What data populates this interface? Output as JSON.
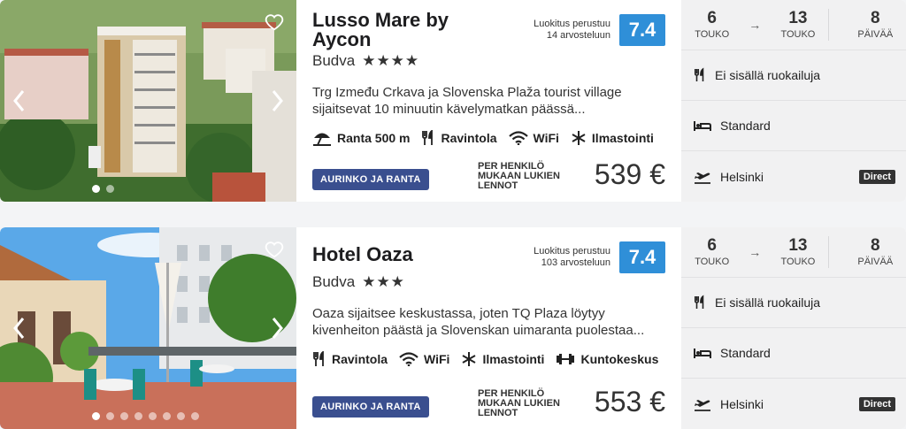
{
  "hotels": [
    {
      "name": "Lusso Mare by Aycon",
      "city": "Budva",
      "stars": "★★★★",
      "rating_label": "Luokitus perustuu",
      "rating_count": "14 arvosteluun",
      "rating_score": "7.4",
      "description": "Trg Između Crkava ja Slovenska Plaža tourist village sijaitsevat 10 minuutin kävelymatkan päässä...",
      "amenities": [
        {
          "icon": "beach-umbrella-icon",
          "label": "Ranta 500 m"
        },
        {
          "icon": "restaurant-icon",
          "label": "Ravintola"
        },
        {
          "icon": "wifi-icon",
          "label": "WiFi"
        },
        {
          "icon": "snowflake-icon",
          "label": "Ilmastointi"
        }
      ],
      "badge": "AURINKO JA RANTA",
      "price_label": "PER HENKILÖ MUKAAN LUKIEN LENNOT",
      "price": "539 €",
      "dates": {
        "start_day": "6",
        "start_month": "TOUKO",
        "end_day": "13",
        "end_month": "TOUKO",
        "nights": "8",
        "nights_label": "PÄIVÄÄ"
      },
      "meals": "Ei sisällä ruokailuja",
      "room": "Standard",
      "departure": "Helsinki",
      "flight_type": "Direct",
      "image_dots": 2,
      "active_dot": 0
    },
    {
      "name": "Hotel Oaza",
      "city": "Budva",
      "stars": "★★★",
      "rating_label": "Luokitus perustuu",
      "rating_count": "103 arvosteluun",
      "rating_score": "7.4",
      "description": "Oaza sijaitsee keskustassa, joten TQ Plaza löytyy kivenheiton päästä ja Slovenskan uimaranta puolestaa...",
      "amenities": [
        {
          "icon": "restaurant-icon",
          "label": "Ravintola"
        },
        {
          "icon": "wifi-icon",
          "label": "WiFi"
        },
        {
          "icon": "snowflake-icon",
          "label": "Ilmastointi"
        },
        {
          "icon": "dumbbell-icon",
          "label": "Kuntokeskus"
        }
      ],
      "badge": "AURINKO JA RANTA",
      "price_label": "PER HENKILÖ MUKAAN LUKIEN LENNOT",
      "price": "553 €",
      "dates": {
        "start_day": "6",
        "start_month": "TOUKO",
        "end_day": "13",
        "end_month": "TOUKO",
        "nights": "8",
        "nights_label": "PÄIVÄÄ"
      },
      "meals": "Ei sisällä ruokailuja",
      "room": "Standard",
      "departure": "Helsinki",
      "flight_type": "Direct",
      "image_dots": 8,
      "active_dot": 0
    }
  ],
  "colors": {
    "rating": "#2f8fd8",
    "badge": "#3a4f8f",
    "side_panel": "#f1f1f2"
  }
}
